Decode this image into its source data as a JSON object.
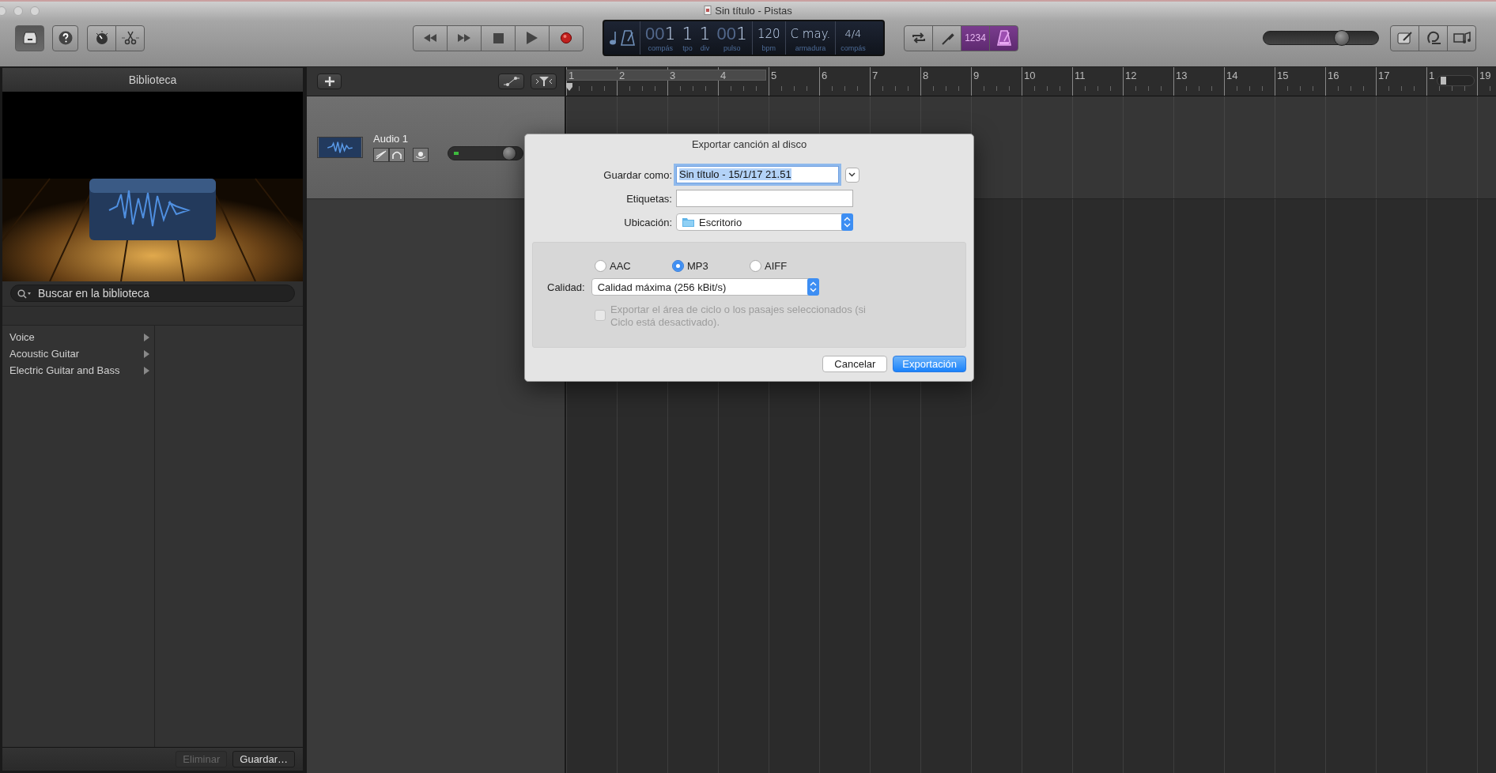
{
  "window": {
    "title": "Sin título - Pistas"
  },
  "toolbar": {
    "library_on": true,
    "lcd": [
      {
        "kind": "time",
        "dim": "00",
        "value": "1",
        "label": "compás"
      },
      {
        "kind": "time",
        "value": "1",
        "label": "tpo"
      },
      {
        "kind": "time",
        "value": "1",
        "label": "div"
      },
      {
        "kind": "time",
        "dim": "00",
        "value": "1",
        "label": "pulso"
      },
      {
        "kind": "field",
        "value": "120",
        "label": "bpm"
      },
      {
        "kind": "field",
        "value": "C may.",
        "label": "armadura"
      },
      {
        "kind": "signature",
        "value": "4/4",
        "label": "compás"
      }
    ],
    "modes": [
      {
        "kind": "cycle",
        "on": false
      },
      {
        "kind": "tuner",
        "on": false
      },
      {
        "kind": "count_in",
        "text": "1234",
        "on": true
      },
      {
        "kind": "metronome",
        "on": true
      }
    ],
    "master_volume": {
      "level": 0.68
    }
  },
  "library": {
    "title": "Biblioteca",
    "search": {
      "placeholder": "Buscar en la biblioteca"
    },
    "items": [
      {
        "label": "Voice",
        "selected": false
      },
      {
        "label": "Acoustic Guitar",
        "selected": false
      },
      {
        "label": "Electric Guitar and Bass",
        "selected": false
      }
    ],
    "buttons": [
      {
        "label": "Eliminar",
        "disabled": true
      },
      {
        "label": "Guardar…",
        "disabled": false
      }
    ]
  },
  "tracks": [
    {
      "name": "Audio 1",
      "volume": {
        "level": 0.82
      }
    }
  ],
  "ruler": {
    "zoom": {
      "level": 0.15
    },
    "bars": [
      "1",
      "2",
      "3",
      "4",
      "5",
      "6",
      "7",
      "8",
      "9",
      "10",
      "11",
      "12",
      "13",
      "14",
      "15",
      "16",
      "17",
      "1",
      "19"
    ]
  },
  "dialog": {
    "title": "Exportar canción al disco",
    "fields": [
      {
        "kind": "text",
        "label": "Guardar como:",
        "value": "Sin título - 15/1/17 21.51",
        "selected_text": true
      },
      {
        "kind": "text",
        "label": "Etiquetas:"
      },
      {
        "kind": "popup",
        "label": "Ubicación:",
        "value": "Escritorio"
      }
    ],
    "formats": [
      {
        "label": "AAC",
        "selected": false
      },
      {
        "label": "MP3",
        "selected": true
      },
      {
        "label": "AIFF",
        "selected": false
      }
    ],
    "quality": {
      "label": "Calidad:",
      "value": "Calidad máxima (256 kBit/s)"
    },
    "cycle_option": {
      "label": "Exportar el área de ciclo o los pasajes seleccionados (si Ciclo está desactivado).",
      "checked": false,
      "disabled": true
    },
    "buttons": [
      {
        "label": "Cancelar",
        "default": false
      },
      {
        "label": "Exportación",
        "default": true
      }
    ]
  }
}
